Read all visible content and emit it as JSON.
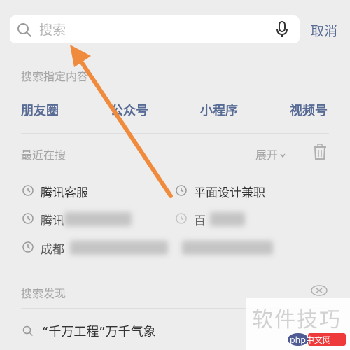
{
  "search": {
    "placeholder": "搜索",
    "cancel_label": "取消"
  },
  "specified_content": {
    "title": "搜索指定内容",
    "tabs": [
      "朋友圈",
      "公众号",
      "小程序",
      "视频号"
    ]
  },
  "recent": {
    "title": "最近在搜",
    "expand_label": "展开",
    "items": [
      "腾讯客服",
      "平面设计兼职",
      "腾讯",
      "百",
      "成都"
    ]
  },
  "discover": {
    "title": "搜索发现",
    "items": [
      "“千万工程”万千气象"
    ]
  },
  "watermark": {
    "text": "软件技巧",
    "logo_text": "php中文网"
  },
  "colors": {
    "link": "#576b95",
    "arrow": "#f08a3c",
    "background": "#ededed"
  }
}
